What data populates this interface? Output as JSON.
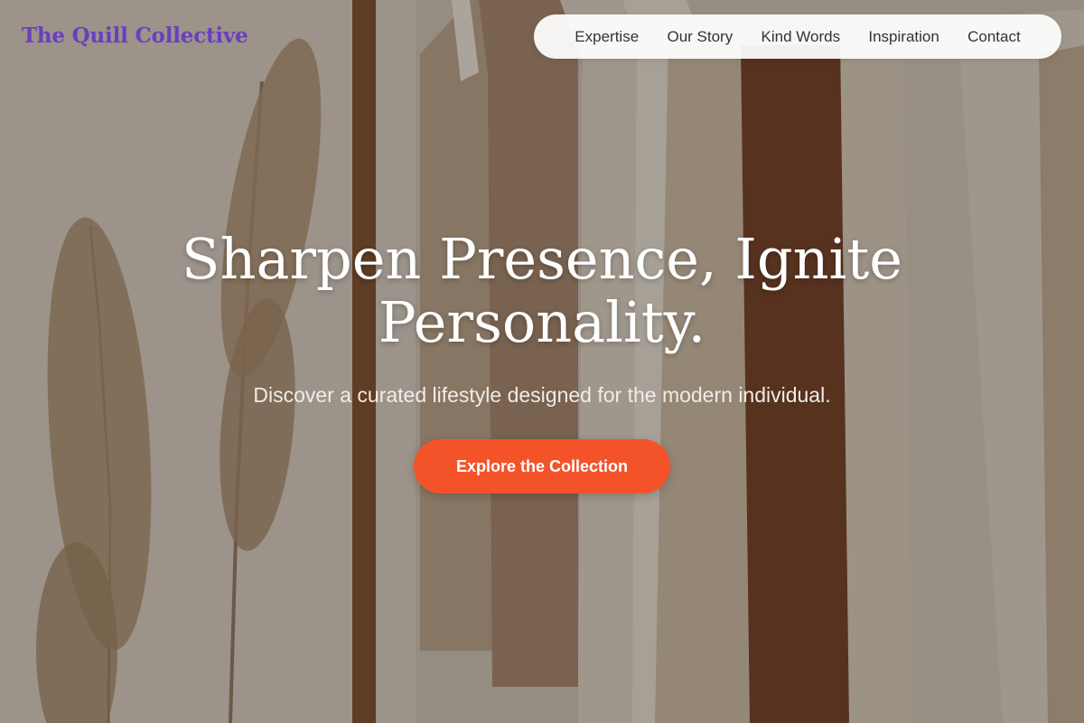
{
  "brand": {
    "name": "The Quill Collective",
    "color": "#6a3fc0"
  },
  "nav": {
    "items": [
      {
        "label": "Expertise"
      },
      {
        "label": "Our Story"
      },
      {
        "label": "Kind Words"
      },
      {
        "label": "Inspiration"
      },
      {
        "label": "Contact"
      }
    ]
  },
  "hero": {
    "title_line1": "Sharpen Presence, Ignite",
    "title_line2": "Personality.",
    "subtitle": "Discover a curated lifestyle designed for the modern individual.",
    "cta_label": "Explore the Collection",
    "cta_color": "#f4532a",
    "background_image": "clothing-rack-with-pampas-grass-photo"
  }
}
